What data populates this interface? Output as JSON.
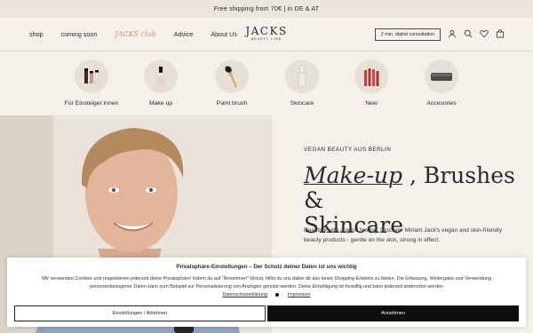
{
  "announcement": "Free shipping from 70€ | in DE & AT",
  "nav": {
    "items": [
      "shop",
      "coming soon",
      "JACKS club",
      "Advice",
      "About Us"
    ]
  },
  "logo": {
    "name": "JACKS",
    "tagline": "BEAUTY LINE"
  },
  "consult_button": "2 min. digital consultation",
  "header_icons": [
    "user-icon",
    "search-icon",
    "heart-icon",
    "cart-icon"
  ],
  "categories": [
    {
      "label": "Für Einsteiger:innen",
      "icon": "starter-set-icon"
    },
    {
      "label": "Make up",
      "icon": "foundation-bottle-icon"
    },
    {
      "label": "Paint brush",
      "icon": "brush-icon"
    },
    {
      "label": "Skincare",
      "icon": "serum-bottle-icon"
    },
    {
      "label": "New",
      "icon": "new-products-icon"
    },
    {
      "label": "Accesories",
      "icon": "case-icon"
    }
  ],
  "hero": {
    "eyebrow": "VEGAN BEAUTY AUS BERLIN",
    "title_italic": "Make-up",
    "title_rest_1": " , Brushes &",
    "title_rest_2": "Skincare",
    "description": "Beautiful with a good feeling: Discover Miriam Jack's vegan and skin-friendly beauty products - gentle on the skin, strong in effect."
  },
  "cookie": {
    "title": "Privatsphäre-Einstellungen – Der Schutz deiner Daten ist uns wichtig",
    "text": "Wir verwenden Cookies und respektieren jederzeit deine Privatsphäre! Indem du auf \"Annehmen\" klickst, hilfst du uns dabei dir das beste Shopping-Erlebnis zu bieten. Die Erfassung, Weitergabe und Verwendung personenbezogener Daten kann zum Beispiel zur Personalisierung von Anzeigen genutzt werden. Deine Einwilligung ist freiwillig und kann jederzeit widerrufen werden",
    "link_privacy": "Datenschutzerklärung",
    "link_imprint": "Impressum",
    "settings_button": "Einstellungen / Ablehnen",
    "accept_button": "Annehmen"
  }
}
